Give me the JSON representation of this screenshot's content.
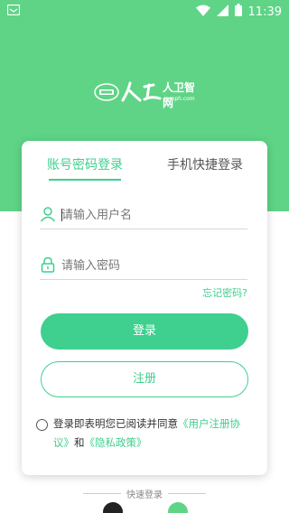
{
  "status_bar": {
    "notification_icon": "notification-icon",
    "wifi_icon": "wifi-icon",
    "signal_icon": "signal-icon",
    "battery_icon": "battery-icon",
    "time": "11:39"
  },
  "logo": {
    "name": "人卫智网",
    "subtext": "ipmph.com"
  },
  "tabs": [
    {
      "label": "账号密码登录",
      "active": true
    },
    {
      "label": "手机快捷登录",
      "active": false
    }
  ],
  "fields": {
    "username": {
      "placeholder": "请输入用户名",
      "value": "",
      "icon": "user-icon"
    },
    "password": {
      "placeholder": "请输入密码",
      "value": "",
      "icon": "lock-icon"
    }
  },
  "forgot_password": "忘记密码?",
  "buttons": {
    "login": "登录",
    "register": "注册"
  },
  "agreement": {
    "text_before": "登录即表明您已阅读并同意",
    "user_agreement": "《用户注册协议》",
    "conjunction": "和",
    "privacy_policy": "《隐私政策》"
  },
  "quick_login": {
    "label": "快速登录"
  },
  "colors": {
    "header_green": "#5fd486",
    "accent_green": "#3fcf8e"
  }
}
